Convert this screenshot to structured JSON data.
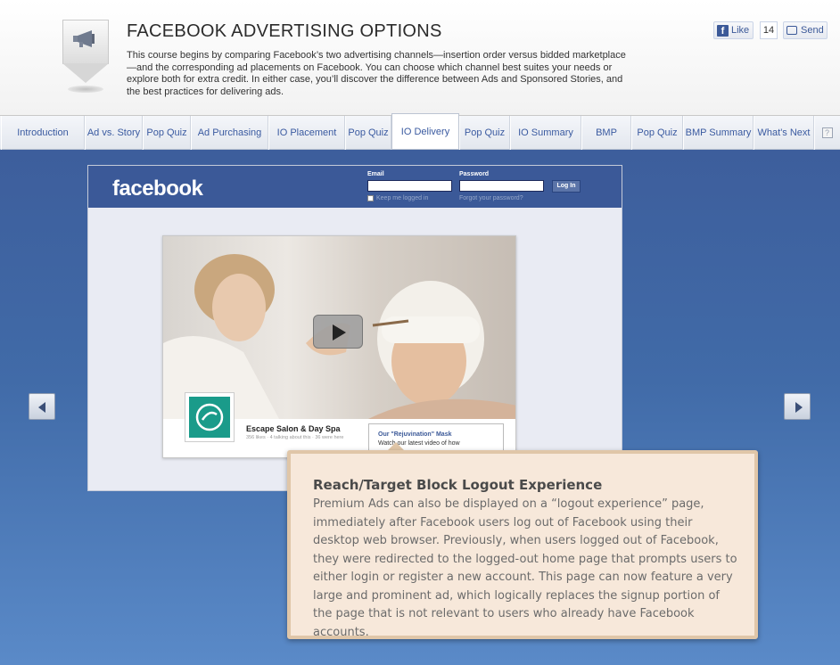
{
  "header": {
    "title": "FACEBOOK ADVERTISING OPTIONS",
    "description": "This course begins by comparing Facebook’s two advertising channels—insertion order versus bidded marketplace—and the corresponding ad placements on Facebook. You can choose which channel best suites your needs or explore both for extra credit. In either case, you’ll discover the difference between Ads and Sponsored Stories, and the best practices for delivering ads.",
    "badge_icon": "megaphone-icon"
  },
  "social": {
    "like_label": "Like",
    "like_count": "14",
    "send_label": "Send"
  },
  "tabs": [
    {
      "label": "Introduction",
      "active": false
    },
    {
      "label": "Ad vs. Story",
      "active": false
    },
    {
      "label": "Pop Quiz",
      "active": false
    },
    {
      "label": "Ad Purchasing",
      "active": false
    },
    {
      "label": "IO Placement",
      "active": false
    },
    {
      "label": "Pop Quiz",
      "active": false
    },
    {
      "label": "IO Delivery",
      "active": true
    },
    {
      "label": "Pop Quiz",
      "active": false
    },
    {
      "label": "IO Summary",
      "active": false
    },
    {
      "label": "BMP",
      "active": false
    },
    {
      "label": "Pop Quiz",
      "active": false
    },
    {
      "label": "BMP Summary",
      "active": false
    },
    {
      "label": "What's Next",
      "active": false
    }
  ],
  "help_label": "?",
  "fb_screen": {
    "logo": "facebook",
    "email_label": "Email",
    "password_label": "Password",
    "login_label": "Log In",
    "keep_logged": "Keep me logged in",
    "forgot": "Forgot your password?",
    "page_name": "Escape Salon & Day Spa",
    "page_meta": "356 likes · 4 talking about this · 36 were here",
    "snippet_title": "Our \"Rejuvination\" Mask",
    "snippet_text": "Watch our latest video of how"
  },
  "tooltip": {
    "title": "Reach/Target Block Logout Experience",
    "body": "Premium Ads can also be displayed on a “logout experience” page, immediately after Facebook users log out of Facebook using their desktop web browser. Previously, when users logged out of Facebook, they were redirected to the logged-out home page that prompts users to either login or register a new account. This page can now feature a very large and prominent ad, which logically replaces the signup portion of the page that is not relevant to users who already have Facebook accounts."
  },
  "colors": {
    "brand_blue": "#3b5998",
    "tab_text": "#3a5aa0",
    "stage_blue": "#416ba8",
    "tooltip_bg": "#f7e8da"
  }
}
